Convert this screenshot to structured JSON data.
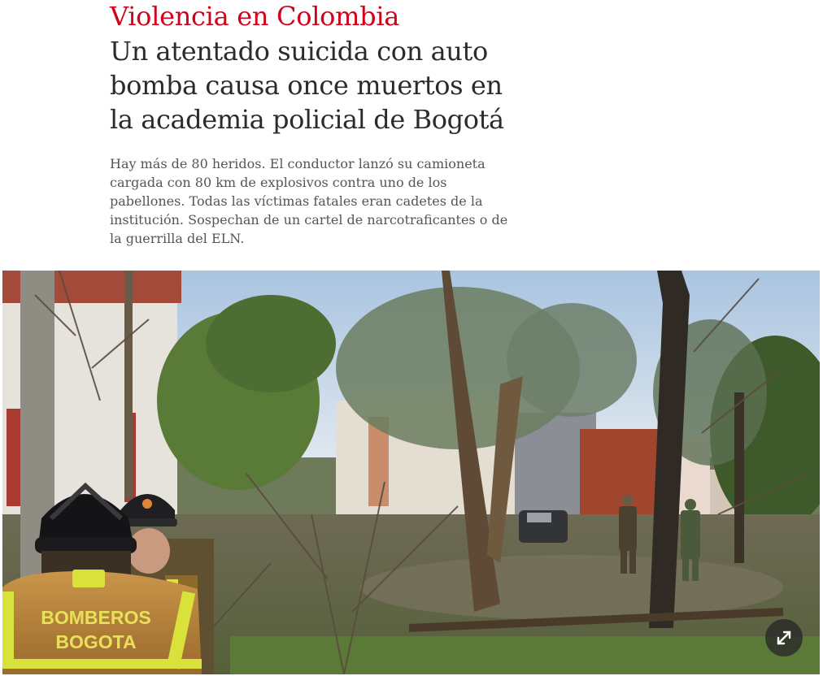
{
  "article": {
    "kicker": "Violencia en Colombia",
    "headline": "Un atentado suicida con auto bomba causa once muertos en la academia policial de Bogotá",
    "summary": "Hay más de 80 heridos. El conductor lanzó su camioneta cargada con 80 km de explosivos contra uno de los pabellones. Todas las víctimas fatales eran cadetes de la institución. Sospechan de un cartel de narcotraficantes o de la guerrilla del ELN."
  },
  "photo": {
    "vest_text_line1": "BOMBEROS",
    "vest_text_line2": "BOGOTA",
    "expand_icon": "expand-arrows-icon"
  },
  "colors": {
    "kicker": "#d0021b",
    "headline": "#2b2b2b",
    "summary": "#555555",
    "vest": "#c08a3e",
    "reflective": "#d8e23a"
  }
}
